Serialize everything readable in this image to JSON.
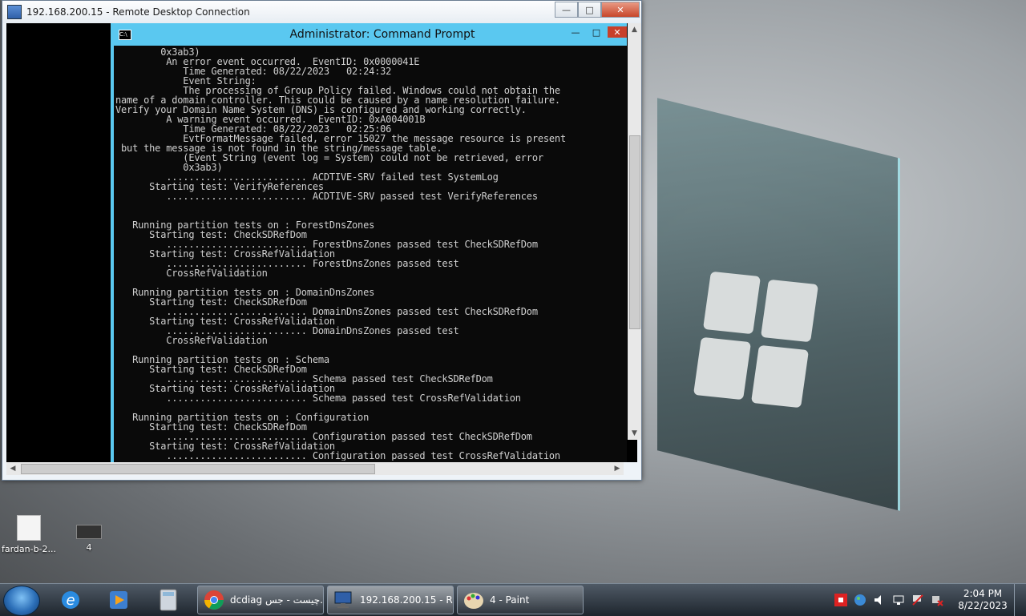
{
  "rdp_window": {
    "title": "192.168.200.15 - Remote Desktop Connection",
    "min_glyph": "—",
    "max_glyph": "□",
    "close_glyph": "✕"
  },
  "cmd_window": {
    "title": "Administrator: Command Prompt",
    "icon_text": "C:\\",
    "output": "        0x3ab3)\n         An error event occurred.  EventID: 0x0000041E\n            Time Generated: 08/22/2023   02:24:32\n            Event String:\n            The processing of Group Policy failed. Windows could not obtain the\nname of a domain controller. This could be caused by a name resolution failure.\nVerify your Domain Name System (DNS) is configured and working correctly.\n         A warning event occurred.  EventID: 0xA004001B\n            Time Generated: 08/22/2023   02:25:06\n            EvtFormatMessage failed, error 15027 the message resource is present\n but the message is not found in the string/message table.\n            (Event String (event log = System) could not be retrieved, error\n            0x3ab3)\n         ......................... ACDTIVE-SRV failed test SystemLog\n      Starting test: VerifyReferences\n         ......................... ACDTIVE-SRV passed test VerifyReferences\n\n\n   Running partition tests on : ForestDnsZones\n      Starting test: CheckSDRefDom\n         ......................... ForestDnsZones passed test CheckSDRefDom\n      Starting test: CrossRefValidation\n         ......................... ForestDnsZones passed test\n         CrossRefValidation\n\n   Running partition tests on : DomainDnsZones\n      Starting test: CheckSDRefDom\n         ......................... DomainDnsZones passed test CheckSDRefDom\n      Starting test: CrossRefValidation\n         ......................... DomainDnsZones passed test\n         CrossRefValidation\n\n   Running partition tests on : Schema\n      Starting test: CheckSDRefDom\n         ......................... Schema passed test CheckSDRefDom\n      Starting test: CrossRefValidation\n         ......................... Schema passed test CrossRefValidation\n\n   Running partition tests on : Configuration\n      Starting test: CheckSDRefDom\n         ......................... Configuration passed test CheckSDRefDom\n      Starting test: CrossRefValidation\n         ......................... Configuration passed test CrossRefValidation"
  },
  "desktop_icons": [
    {
      "label": "fardan-b-2...",
      "icon": "document-icon"
    },
    {
      "label": "4",
      "icon": "computer-icon"
    }
  ],
  "taskbar": {
    "tasks": [
      {
        "label": "dcdiag چیست - جس...",
        "icon": "chrome-icon"
      },
      {
        "label": "192.168.200.15 - R...",
        "icon": "remote-desktop-icon"
      },
      {
        "label": "4 - Paint",
        "icon": "paint-icon"
      }
    ],
    "clock_time": "2:04 PM",
    "clock_date": "8/22/2023"
  },
  "colors": {
    "cmd_accent": "#5ac8f0",
    "close_red": "#c7462a"
  }
}
